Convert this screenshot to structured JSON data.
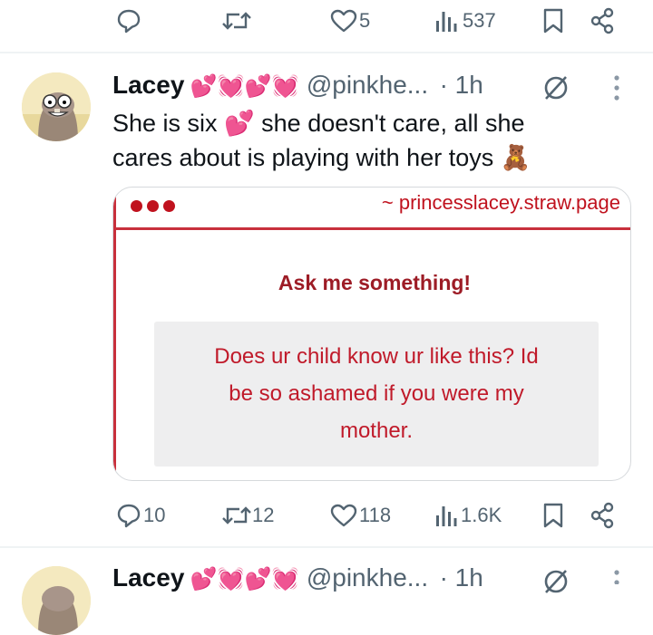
{
  "top_actions": {
    "reply_count": "",
    "retweet_count": "",
    "like_count": "5",
    "view_count": "537"
  },
  "tweet": {
    "display_name": "Lacey",
    "name_emojis": "💕💓💕💓",
    "handle": "@pinkhe...",
    "time": "· 1h",
    "text_line1": "She is six 💕 she doesn't care, all she",
    "text_line2": "cares about is playing with her toys 🧸",
    "card": {
      "url": "~ princesslacey.straw.page",
      "title": "Ask me something!",
      "question_line1": "Does ur child know ur like this? Id",
      "question_line2": "be so ashamed if you were my",
      "question_line3": "mother."
    },
    "actions": {
      "reply_count": "10",
      "retweet_count": "12",
      "like_count": "118",
      "view_count": "1.6K"
    }
  },
  "next_tweet": {
    "display_name": "Lacey",
    "name_emojis": "💕💓💕💓",
    "handle": "@pinkhe...",
    "time": "· 1h"
  },
  "colors": {
    "icon_gray": "#536471",
    "card_red": "#c0121e",
    "divider": "#eff3f4"
  }
}
